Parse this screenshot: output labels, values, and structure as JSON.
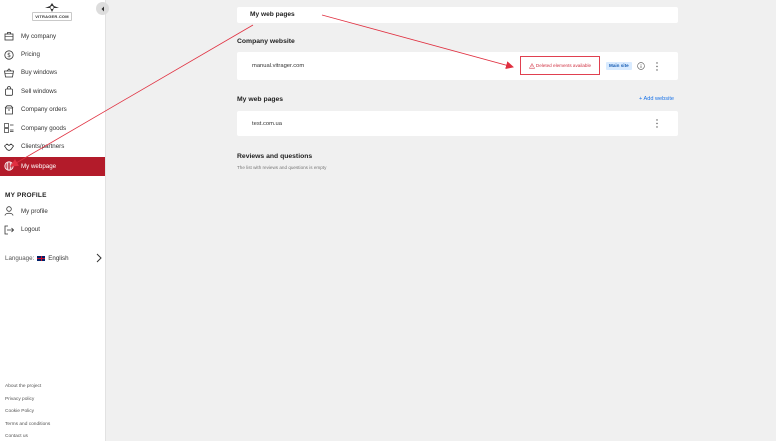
{
  "logo": {
    "text": "VITRAGER.COM"
  },
  "sidebar": {
    "items": [
      {
        "label": "My company",
        "icon": "briefcase-icon"
      },
      {
        "label": "Pricing",
        "icon": "dollar-icon"
      },
      {
        "label": "Buy windows",
        "icon": "cart-icon"
      },
      {
        "label": "Sell windows",
        "icon": "bag-icon"
      },
      {
        "label": "Company orders",
        "icon": "box-icon"
      },
      {
        "label": "Company goods",
        "icon": "goods-icon"
      },
      {
        "label": "Clients/partners",
        "icon": "handshake-icon"
      },
      {
        "label": "My webpage",
        "icon": "globe-icon",
        "active": true
      }
    ],
    "profile_title": "MY PROFILE",
    "profile_items": [
      {
        "label": "My profile",
        "icon": "user-icon"
      },
      {
        "label": "Logout",
        "icon": "logout-icon"
      }
    ],
    "language_label": "Language:",
    "language_value": "English",
    "footer_links": [
      "About the project",
      "Privacy policy",
      "Cookie Policy",
      "Terms and conditions",
      "Contact us"
    ]
  },
  "main": {
    "top_title": "My web pages",
    "company_website_title": "Company website",
    "company_site": {
      "url": "manual.vitrager.com",
      "warning": "Deleted elements available",
      "badge": "Main site"
    },
    "my_pages_title": "My web pages",
    "add_label": "+ Add website",
    "my_site": {
      "url": "test.com.ua"
    },
    "reviews_title": "Reviews and questions",
    "reviews_empty": "The list with reviews and questions is empty"
  },
  "colors": {
    "accent": "#b31b2a",
    "link": "#1a73e8",
    "badge_bg": "#d9ebff",
    "annotation": "#e03040"
  }
}
